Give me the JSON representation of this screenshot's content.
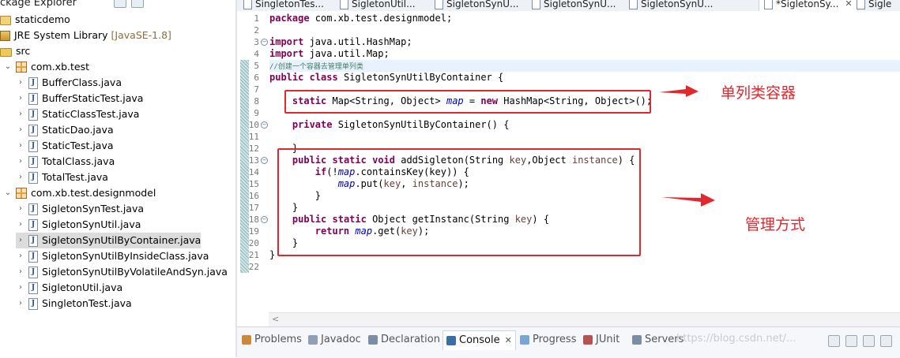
{
  "explorer": {
    "title": "ckage Explorer",
    "tree": [
      {
        "label": "staticdemo",
        "icon": "project-icon",
        "twisty": "",
        "indent": 0
      },
      {
        "label": "JRE System Library",
        "suffix": "[JavaSE-1.8]",
        "icon": "library-icon",
        "twisty": ">",
        "indent": 0
      },
      {
        "label": "src",
        "icon": "source-folder-icon",
        "twisty": "",
        "indent": 0
      },
      {
        "label": "com.xb.test",
        "icon": "package-icon",
        "twisty": "v",
        "indent": 0
      },
      {
        "label": "BufferClass.java",
        "icon": "java-file-icon",
        "twisty": ">",
        "indent": 1
      },
      {
        "label": "BufferStaticTest.java",
        "icon": "java-file-icon",
        "twisty": ">",
        "indent": 1
      },
      {
        "label": "StaticClassTest.java",
        "icon": "java-file-icon",
        "twisty": ">",
        "indent": 1
      },
      {
        "label": "StaticDao.java",
        "icon": "java-file-icon",
        "twisty": ">",
        "indent": 1
      },
      {
        "label": "StaticTest.java",
        "icon": "java-file-icon",
        "twisty": ">",
        "indent": 1
      },
      {
        "label": "TotalClass.java",
        "icon": "java-file-icon",
        "twisty": ">",
        "indent": 1
      },
      {
        "label": "TotalTest.java",
        "icon": "java-file-icon",
        "twisty": ">",
        "indent": 1
      },
      {
        "label": "com.xb.test.designmodel",
        "icon": "package-icon",
        "twisty": "v",
        "indent": 0
      },
      {
        "label": "SigletonSynTest.java",
        "icon": "java-file-icon",
        "twisty": ">",
        "indent": 1
      },
      {
        "label": "SigletonSynUtil.java",
        "icon": "java-file-icon",
        "twisty": ">",
        "indent": 1
      },
      {
        "label": "SigletonSynUtilByContainer.java",
        "icon": "java-file-icon",
        "twisty": ">",
        "indent": 1,
        "selected": true
      },
      {
        "label": "SigletonSynUtilByInsideClass.java",
        "icon": "java-file-icon",
        "twisty": ">",
        "indent": 1
      },
      {
        "label": "SigletonSynUtilByVolatileAndSyn.java",
        "icon": "java-file-icon",
        "twisty": ">",
        "indent": 1
      },
      {
        "label": "SigletonUtil.java",
        "icon": "java-file-icon",
        "twisty": ">",
        "indent": 1
      },
      {
        "label": "SingletonTest.java",
        "icon": "java-file-icon",
        "twisty": ">",
        "indent": 1
      }
    ]
  },
  "editor": {
    "tabs": [
      {
        "label": "SingletonTes...",
        "active": false
      },
      {
        "label": "SigletonUtil...",
        "active": false
      },
      {
        "label": "SigletonSynU...",
        "active": false
      },
      {
        "label": "SigletonSynU...",
        "active": false
      },
      {
        "label": "SigletonSynU...",
        "active": false
      },
      {
        "label": "*SigletonSy...",
        "active": true,
        "close": "✕"
      },
      {
        "label": "Sigle",
        "active": false
      }
    ],
    "line_numbers": [
      "1",
      "2",
      "3",
      "4",
      "5",
      "6",
      "7",
      "8",
      "9",
      "10",
      "11",
      "12",
      "13",
      "14",
      "15",
      "16",
      "17",
      "18",
      "19",
      "20",
      "21",
      "22"
    ],
    "code": {
      "l1_kw": "package",
      "l1_rest": " com.xb.test.designmodel;",
      "l3_kw": "import",
      "l3_rest": " java.util.HashMap;",
      "l4_kw": "import",
      "l4_rest": " java.util.Map;",
      "l5_comment": "//创建一个容器去管理单列类",
      "l6_kw1": "public",
      "l6_kw2": "class",
      "l6_rest": " SigletonSynUtilByContainer {",
      "l8_kw1": "static",
      "l8_a": " Map<String, Object> ",
      "l8_field": "map",
      "l8_b": " = ",
      "l8_kw2": "new",
      "l8_c": " HashMap<String, Object>();",
      "l10_kw": "private",
      "l10_rest": " SigletonSynUtilByContainer() {",
      "l12_rest": "}",
      "l13_kw1": "public",
      "l13_kw2": "static",
      "l13_kw3": "void",
      "l13_a": " addSigleton(String ",
      "l13_p1": "key",
      "l13_b": ",Object ",
      "l13_p2": "instance",
      "l13_c": ") {",
      "l14_kw": "if",
      "l14_a": "(!",
      "l14_field": "map",
      "l14_b": ".containsKey(key)) {",
      "l15_field": "map",
      "l15_a": ".put(",
      "l15_p1": "key",
      "l15_b": ", ",
      "l15_p2": "instance",
      "l15_c": ");",
      "l16_rest": "}",
      "l17_rest": "}",
      "l18_kw1": "public",
      "l18_kw2": "static",
      "l18_a": " Object getInstanc(String ",
      "l18_p1": "key",
      "l18_b": ") {",
      "l19_kw": "return",
      "l19_field": "map",
      "l19_a": ".get(",
      "l19_p1": "key",
      "l19_b": ");",
      "l20_rest": "}",
      "l21_rest": "}"
    },
    "scroll_arrow": "<"
  },
  "annotations": {
    "label_container": "单列类容器",
    "label_manage": "管理方式",
    "color": "#e2272e"
  },
  "bottom_views": {
    "tabs": [
      {
        "label": "Problems",
        "icon": "problems-icon",
        "active": false
      },
      {
        "label": "Javadoc",
        "icon": "javadoc-icon",
        "active": false
      },
      {
        "label": "Declaration",
        "icon": "declaration-icon",
        "active": false
      },
      {
        "label": "Console",
        "icon": "console-icon",
        "active": true,
        "close": "✕"
      },
      {
        "label": "Progress",
        "icon": "progress-icon",
        "active": false
      },
      {
        "label": "JUnit",
        "icon": "junit-icon",
        "active": false
      },
      {
        "label": "Servers",
        "icon": "servers-icon",
        "active": false
      }
    ],
    "watermark": "https://blog.csdn.net/..."
  }
}
